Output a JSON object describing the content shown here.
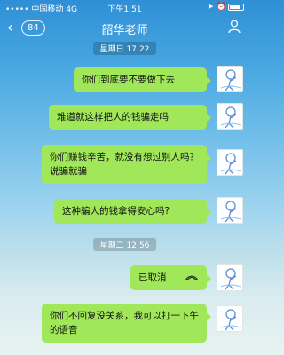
{
  "status": {
    "carrier": "中国移动",
    "network": "4G",
    "time": "下午1:51"
  },
  "nav": {
    "back_count": "84",
    "title": "韶华老师"
  },
  "messages": [
    {
      "type": "time",
      "text": "星期日 17:22"
    },
    {
      "type": "text",
      "text": "你们到底要不要做下去"
    },
    {
      "type": "text",
      "text": "难道就这样把人的钱骗走吗"
    },
    {
      "type": "text",
      "text": "你们赚钱辛苦，就没有想过别人吗？说骗就骗"
    },
    {
      "type": "text",
      "text": "这种骗人的钱拿得安心吗?"
    },
    {
      "type": "time",
      "text": "星期二 12:56"
    },
    {
      "type": "call",
      "text": "已取消"
    },
    {
      "type": "text",
      "text": "你们不回复没关系，我可以打一下午的语音"
    }
  ],
  "icons": {
    "back": "chevron-left-icon",
    "profile": "person-icon",
    "call": "phone-hangup-icon",
    "avatar": "cartoon-avatar"
  },
  "colors": {
    "bubble": "#a0e75a",
    "nav_text": "#ffffff"
  }
}
